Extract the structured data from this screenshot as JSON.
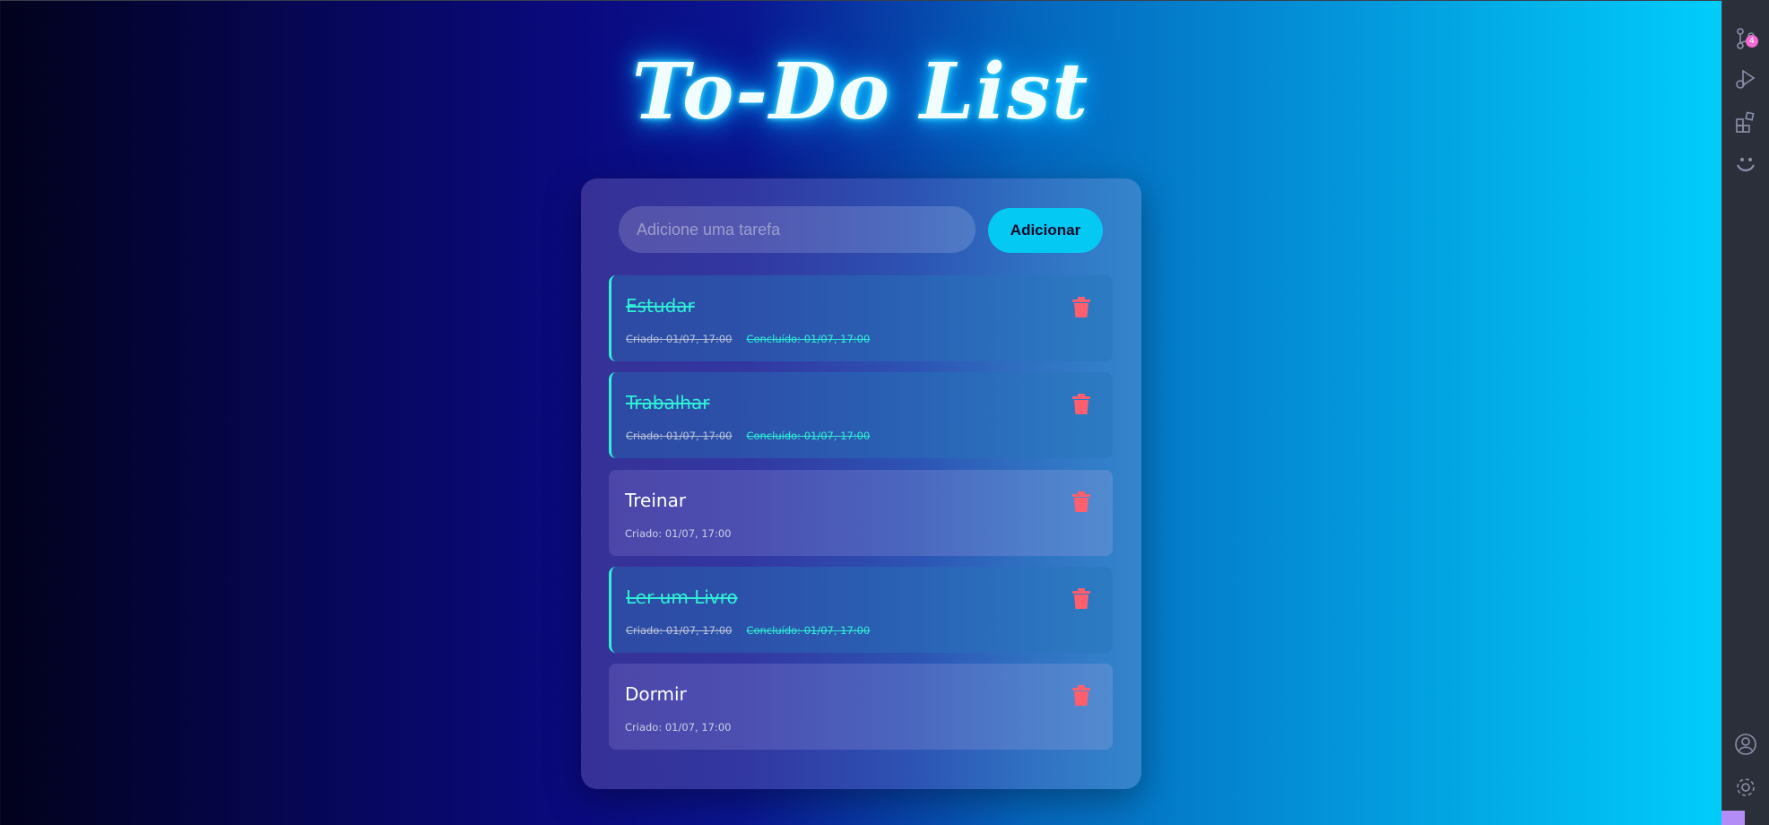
{
  "app": {
    "title": "To-Do List",
    "input_placeholder": "Adicione uma tarefa",
    "add_button_label": "Adicionar"
  },
  "tasks": [
    {
      "title": "Estudar",
      "created": "Criado: 01/07, 17:00",
      "completed": "Concluído: 01/07, 17:00",
      "done": true
    },
    {
      "title": "Trabalhar",
      "created": "Criado: 01/07, 17:00",
      "completed": "Concluído: 01/07, 17:00",
      "done": true
    },
    {
      "title": "Treinar",
      "created": "Criado: 01/07, 17:00",
      "completed": "",
      "done": false
    },
    {
      "title": "Ler um Livro",
      "created": "Criado: 01/07, 17:00",
      "completed": "Concluído: 01/07, 17:00",
      "done": true
    },
    {
      "title": "Dormir",
      "created": "Criado: 01/07, 17:00",
      "completed": "",
      "done": false
    }
  ],
  "activity_bar": {
    "items": [
      "source-control-icon",
      "run-debug-icon",
      "extensions-icon",
      "smiley-icon"
    ],
    "bottom_items": [
      "account-icon",
      "settings-icon"
    ],
    "source_control_badge": "4"
  },
  "colors": {
    "accent": "#04c9f2",
    "done": "#2ff0d6",
    "delete": "#ff5f6d",
    "activity_bar_bg": "#2b2f3a"
  }
}
